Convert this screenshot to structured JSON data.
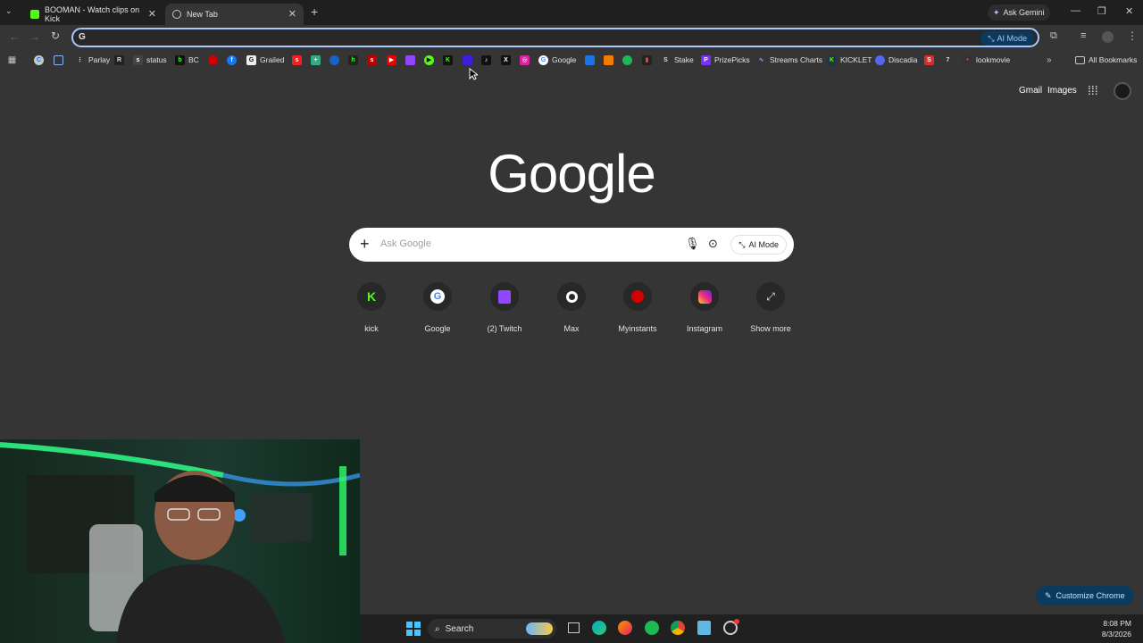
{
  "tabs": [
    {
      "title": "BOOMAN - Watch clips on Kick"
    },
    {
      "title": "New Tab"
    }
  ],
  "ask_gemini": "Ask Gemini",
  "omnibox": {
    "value": "",
    "ai_mode_label": "AI Mode"
  },
  "bookmarks": [
    {
      "label": "Parlay"
    },
    {
      "label": "status"
    },
    {
      "label": "BC"
    },
    {
      "label": "Grailed"
    },
    {
      "label": "Google"
    },
    {
      "label": "Stake"
    },
    {
      "label": "PrizePicks"
    },
    {
      "label": "Streams Charts"
    },
    {
      "label": "KICKLET"
    },
    {
      "label": "Discadia"
    },
    {
      "label": "lookmovie"
    }
  ],
  "all_bookmarks": "All Bookmarks",
  "header": {
    "gmail": "Gmail",
    "images": "Images"
  },
  "logo": "Google",
  "search": {
    "placeholder": "Ask Google",
    "ai_mode": "AI Mode"
  },
  "shortcuts": [
    {
      "label": "kick"
    },
    {
      "label": "Google"
    },
    {
      "label": "(2) Twitch"
    },
    {
      "label": "Max"
    },
    {
      "label": "Myinstants"
    },
    {
      "label": "Instagram"
    },
    {
      "label": "Show more"
    }
  ],
  "customize": "Customize Chrome",
  "taskbar": {
    "search": "Search",
    "time": "8:08 PM",
    "date": "8/3/2026"
  },
  "colors": {
    "accent": "#a8c7fa",
    "page_bg": "#353535",
    "tabstrip_bg": "#1f1f1f"
  }
}
